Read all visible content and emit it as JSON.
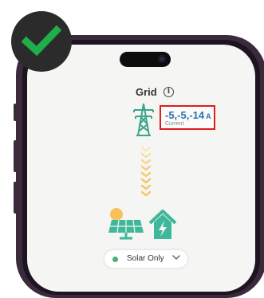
{
  "status": {
    "icon": "checkmark-icon",
    "color": "#1fae4a"
  },
  "device": {
    "notch": "dynamic-island"
  },
  "grid": {
    "title": "Grid",
    "info_icon": "i",
    "readout": {
      "value": "-5,-5,-14",
      "unit": "A",
      "label": "Current"
    }
  },
  "flow": {
    "direction": "down",
    "color": "#f5c45e"
  },
  "sources": [
    {
      "name": "solar-panel",
      "color": "#3fb89a"
    },
    {
      "name": "home",
      "color": "#3fb89a"
    }
  ],
  "mode_selector": {
    "selected": "Solar Only",
    "status_color": "#4caf7d"
  }
}
